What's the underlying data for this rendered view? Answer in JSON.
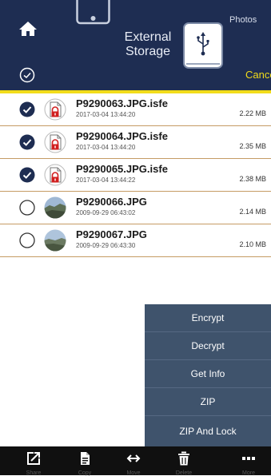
{
  "header": {
    "title": "External\nStorage",
    "right_label": "Photos",
    "cancel_label": "Cancel",
    "accent": "#f2dc1a",
    "background": "#1e2d52"
  },
  "files": [
    {
      "name": "P9290063.JPG.isfe",
      "date": "2017-03-04 13:44:20",
      "size": "2.22 MB",
      "selected": true,
      "type": "locked"
    },
    {
      "name": "P9290064.JPG.isfe",
      "date": "2017-03-04 13:44:20",
      "size": "2.35 MB",
      "selected": true,
      "type": "locked"
    },
    {
      "name": "P9290065.JPG.isfe",
      "date": "2017-03-04 13:44:22",
      "size": "2.38 MB",
      "selected": true,
      "type": "locked"
    },
    {
      "name": "P9290066.JPG",
      "date": "2009-09-29 06:43:02",
      "size": "2.14 MB",
      "selected": false,
      "type": "photo"
    },
    {
      "name": "P9290067.JPG",
      "date": "2009-09-29 06:43:30",
      "size": "2.10 MB",
      "selected": false,
      "type": "photo"
    }
  ],
  "menu": {
    "items": [
      "Encrypt",
      "Decrypt",
      "Get Info",
      "ZIP",
      "ZIP And Lock"
    ]
  },
  "toolbar": {
    "items": [
      {
        "label": "Share",
        "icon": "share-icon"
      },
      {
        "label": "Copy",
        "icon": "copy-icon"
      },
      {
        "label": "Move",
        "icon": "move-icon"
      },
      {
        "label": "Delete",
        "icon": "trash-icon"
      },
      {
        "label": "More",
        "icon": "more-icon"
      }
    ]
  }
}
